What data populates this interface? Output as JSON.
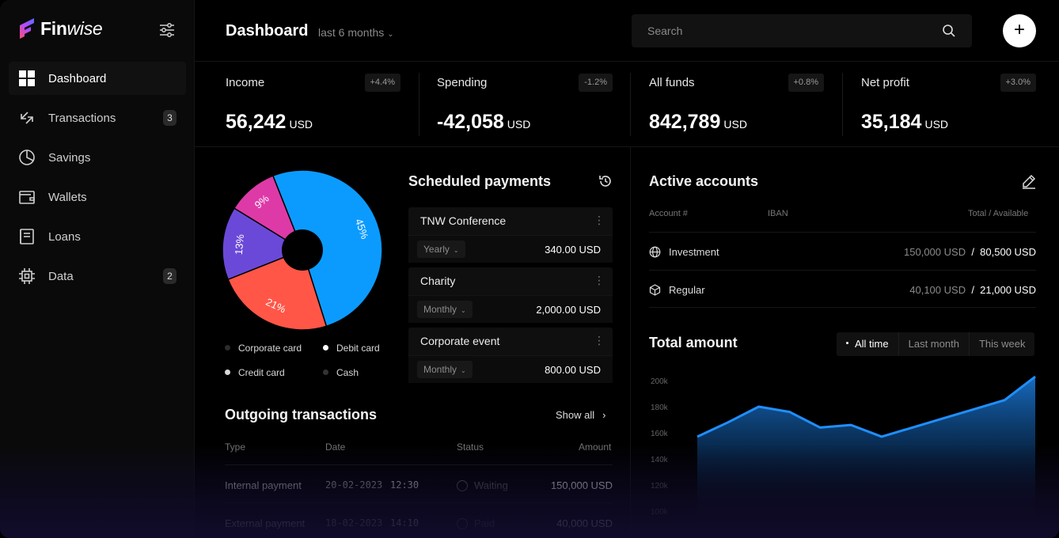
{
  "brand": {
    "name_bold": "Fin",
    "name_italic": "wise"
  },
  "sidebar": {
    "items": [
      {
        "label": "Dashboard",
        "badge": ""
      },
      {
        "label": "Transactions",
        "badge": "3"
      },
      {
        "label": "Savings",
        "badge": ""
      },
      {
        "label": "Wallets",
        "badge": ""
      },
      {
        "label": "Loans",
        "badge": ""
      },
      {
        "label": "Data",
        "badge": "2"
      }
    ]
  },
  "header": {
    "title": "Dashboard",
    "period": "last 6 months",
    "search_placeholder": "Search",
    "add_label": "+"
  },
  "stats": [
    {
      "label": "Income",
      "change": "+4.4%",
      "value": "56,242",
      "unit": "USD"
    },
    {
      "label": "Spending",
      "change": "-1.2%",
      "value": "-42,058",
      "unit": "USD"
    },
    {
      "label": "All funds",
      "change": "+0.8%",
      "value": "842,789",
      "unit": "USD"
    },
    {
      "label": "Net profit",
      "change": "+3.0%",
      "value": "35,184",
      "unit": "USD"
    }
  ],
  "pie": {
    "slices": [
      {
        "label": "45%",
        "value": 45,
        "color": "#0b9bff"
      },
      {
        "label": "21%",
        "value": 21,
        "color": "#ff5647"
      },
      {
        "label": "13%",
        "value": 13,
        "color": "#6b49d8"
      },
      {
        "label": "9%",
        "value": 9,
        "color": "#dd3aa7"
      }
    ],
    "legend": [
      {
        "label": "Corporate card",
        "color": "#2c2c2c"
      },
      {
        "label": "Debit card",
        "color": "#ffffff"
      },
      {
        "label": "Credit card",
        "color": "#d8d8d8"
      },
      {
        "label": "Cash",
        "color": "#333333"
      }
    ]
  },
  "scheduled": {
    "title": "Scheduled payments",
    "items": [
      {
        "name": "TNW Conference",
        "freq": "Yearly",
        "amount": "340.00 USD"
      },
      {
        "name": "Charity",
        "freq": "Monthly",
        "amount": "2,000.00 USD"
      },
      {
        "name": "Corporate event",
        "freq": "Monthly",
        "amount": "800.00 USD"
      }
    ]
  },
  "outgoing": {
    "title": "Outgoing transactions",
    "show_all": "Show all",
    "columns": [
      "Type",
      "Date",
      "Status",
      "Amount"
    ],
    "rows": [
      {
        "type": "Internal payment",
        "date": "20-02-2023",
        "time": "12:30",
        "status": "Waiting",
        "amount": "150,000 USD"
      },
      {
        "type": "External payment",
        "date": "18-02-2023",
        "time": "14:10",
        "status": "Paid",
        "amount": "40,000 USD"
      }
    ]
  },
  "accounts": {
    "title": "Active accounts",
    "columns": [
      "Account #",
      "IBAN",
      "Total / Available"
    ],
    "rows": [
      {
        "name": "Investment",
        "total": "150,000",
        "total_unit": "USD",
        "available": "80,500",
        "available_unit": "USD"
      },
      {
        "name": "Regular",
        "total": "40,100",
        "total_unit": "USD",
        "available": "21,000",
        "available_unit": "USD"
      }
    ]
  },
  "total_amount": {
    "title": "Total amount",
    "filters": [
      "All time",
      "Last month",
      "This week"
    ]
  },
  "chart_data": {
    "type": "area",
    "title": "Total amount",
    "y_ticks": [
      "200k",
      "180k",
      "160k",
      "140k",
      "120k",
      "100k"
    ],
    "ylim": [
      100,
      200
    ],
    "x": [
      0,
      1,
      2,
      3,
      4,
      5,
      6,
      7,
      8,
      9,
      10,
      11
    ],
    "values": [
      157,
      168,
      180,
      176,
      164,
      166,
      157,
      164,
      171,
      178,
      185,
      203
    ],
    "color": "#1f8fff"
  }
}
